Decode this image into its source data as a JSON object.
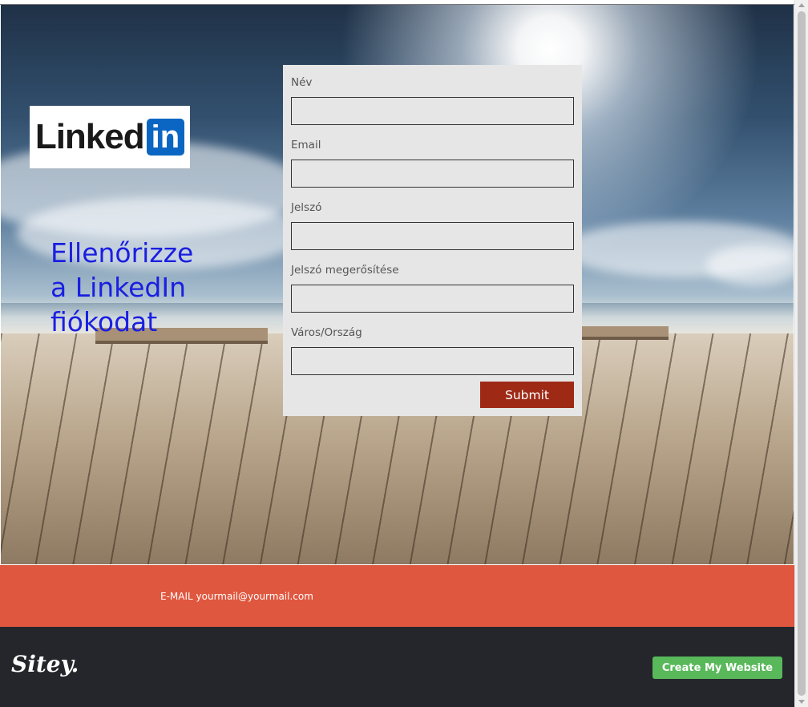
{
  "hero": {
    "logo": {
      "word": "Linked",
      "badge": "in",
      "icon": "linkedin-logo"
    },
    "headline_lines": [
      "Ellenőrizze",
      "a LinkedIn",
      "fiókodat"
    ],
    "headline_color": "#1a1fe0"
  },
  "form": {
    "fields": [
      {
        "label": "Név",
        "value": ""
      },
      {
        "label": "Email",
        "value": ""
      },
      {
        "label": "Jelszó",
        "value": ""
      },
      {
        "label": "Jelszó megerősítése",
        "value": ""
      },
      {
        "label": "Város/Ország",
        "value": ""
      }
    ],
    "submit_label": "Submit",
    "submit_color": "#9e2a16"
  },
  "contact": {
    "text": "E-MAIL yourmail@yourmail.com",
    "bar_color": "#e0573f"
  },
  "footer": {
    "brand": "Sitey.",
    "cta_label": "Create My Website",
    "cta_color": "#58b85a"
  }
}
